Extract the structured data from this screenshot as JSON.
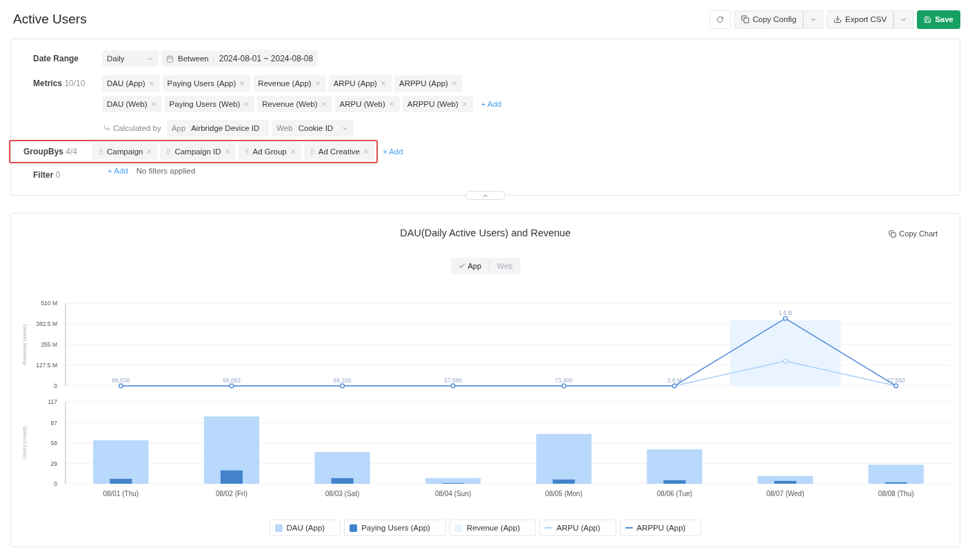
{
  "page": {
    "title": "Active Users"
  },
  "toolbar": [
    {
      "kind": "refresh"
    },
    {
      "kind": "copy",
      "label": "Copy Config",
      "split": true
    },
    {
      "kind": "export",
      "label": "Export CSV",
      "split": true
    },
    {
      "kind": "save",
      "label": "Save",
      "split": false
    }
  ],
  "config": {
    "date_range": {
      "label": "Date Range",
      "interval": "Daily",
      "range_label": "Between",
      "range": "2024-08-01 ~ 2024-08-08"
    },
    "metrics": {
      "label": "Metrics",
      "count": "10/10",
      "rows": [
        [
          "DAU (App)",
          "Paying Users (App)",
          "Revenue (App)",
          "ARPU (App)",
          "ARPPU (App)"
        ],
        [
          "DAU (Web)",
          "Paying Users (Web)",
          "Revenue (Web)",
          "ARPU (Web)",
          "ARPPU (Web)"
        ]
      ],
      "add": "+ Add",
      "calculated_by": {
        "label": "Calculated by",
        "app_label": "App",
        "app_value": "Airbridge Device ID",
        "web_label": "Web",
        "web_value": "Cookie ID"
      }
    },
    "groupbys": {
      "label": "GroupBys",
      "count": "4/4",
      "highlighted": true,
      "items": [
        "Campaign",
        "Campaign ID",
        "Ad Group",
        "Ad Creative"
      ],
      "add": "+ Add"
    },
    "filter": {
      "label": "Filter",
      "count": "0",
      "add": "+ Add",
      "empty": "No filters applied"
    }
  },
  "chart_panel": {
    "title": "DAU(Daily Active Users) and Revenue",
    "copy_button": "Copy Chart",
    "toggle": [
      {
        "label": "App",
        "selected": true
      },
      {
        "label": "Web",
        "selected": false
      }
    ],
    "users_chart": {
      "chart_data": {
        "type": "bar",
        "ylabel": "Users (count)",
        "ylim": [
          0,
          117
        ],
        "grid": true,
        "categories": [
          "08/01 (Thu)",
          "08/02 (Fri)",
          "08/03 (Sat)",
          "08/04 (Sun)",
          "08/05 (Mon)",
          "08/06 (Tue)",
          "08/07 (Wed)",
          "08/08 (Thu)"
        ],
        "yticks": [
          0,
          29,
          58,
          87,
          117
        ],
        "series": [
          {
            "name": "DAU (App)",
            "color": "#b8d8fc",
            "values": [
              62,
              96,
              45,
              8,
              71,
              49,
              11,
              27
            ]
          },
          {
            "name": "Paying Users (App)",
            "color": "#4283cc",
            "values": [
              7,
              19,
              8,
              1,
              6,
              5,
              4,
              2
            ]
          }
        ]
      }
    },
    "revenue_chart": {
      "chart_data": {
        "type": "line",
        "ylabel": "Revenue (value)",
        "ylim": [
          0,
          510000000
        ],
        "grid": true,
        "yticks": [
          {
            "value": 0,
            "label": "0"
          },
          {
            "value": 127500000,
            "label": "127.5 M"
          },
          {
            "value": 255000000,
            "label": "255 M"
          },
          {
            "value": 382500000,
            "label": "382.5 M"
          },
          {
            "value": 510000000,
            "label": "510 M"
          }
        ],
        "series": [
          {
            "name": "Revenue (App)",
            "type": "bar",
            "color": "#eaf4ff",
            "values": [
              0,
              0,
              0,
              0,
              0,
              0,
              404000000,
              0
            ]
          },
          {
            "name": "ARPU (App)",
            "color": "#a8d0fb",
            "marker": "o",
            "values": [
              0,
              0,
              0,
              0,
              0,
              0,
              153000000,
              0
            ]
          },
          {
            "name": "ARPPU (App)",
            "color": "#4f8bd6",
            "marker": "o",
            "values": [
              0,
              0,
              0,
              0,
              0,
              0,
              416000000,
              0
            ]
          }
        ],
        "value_labels": [
          "98,038",
          "98,893",
          "69,106",
          "57,586",
          "73,400",
          "2.8 M",
          "1.6 B",
          "27,550"
        ]
      }
    }
  }
}
